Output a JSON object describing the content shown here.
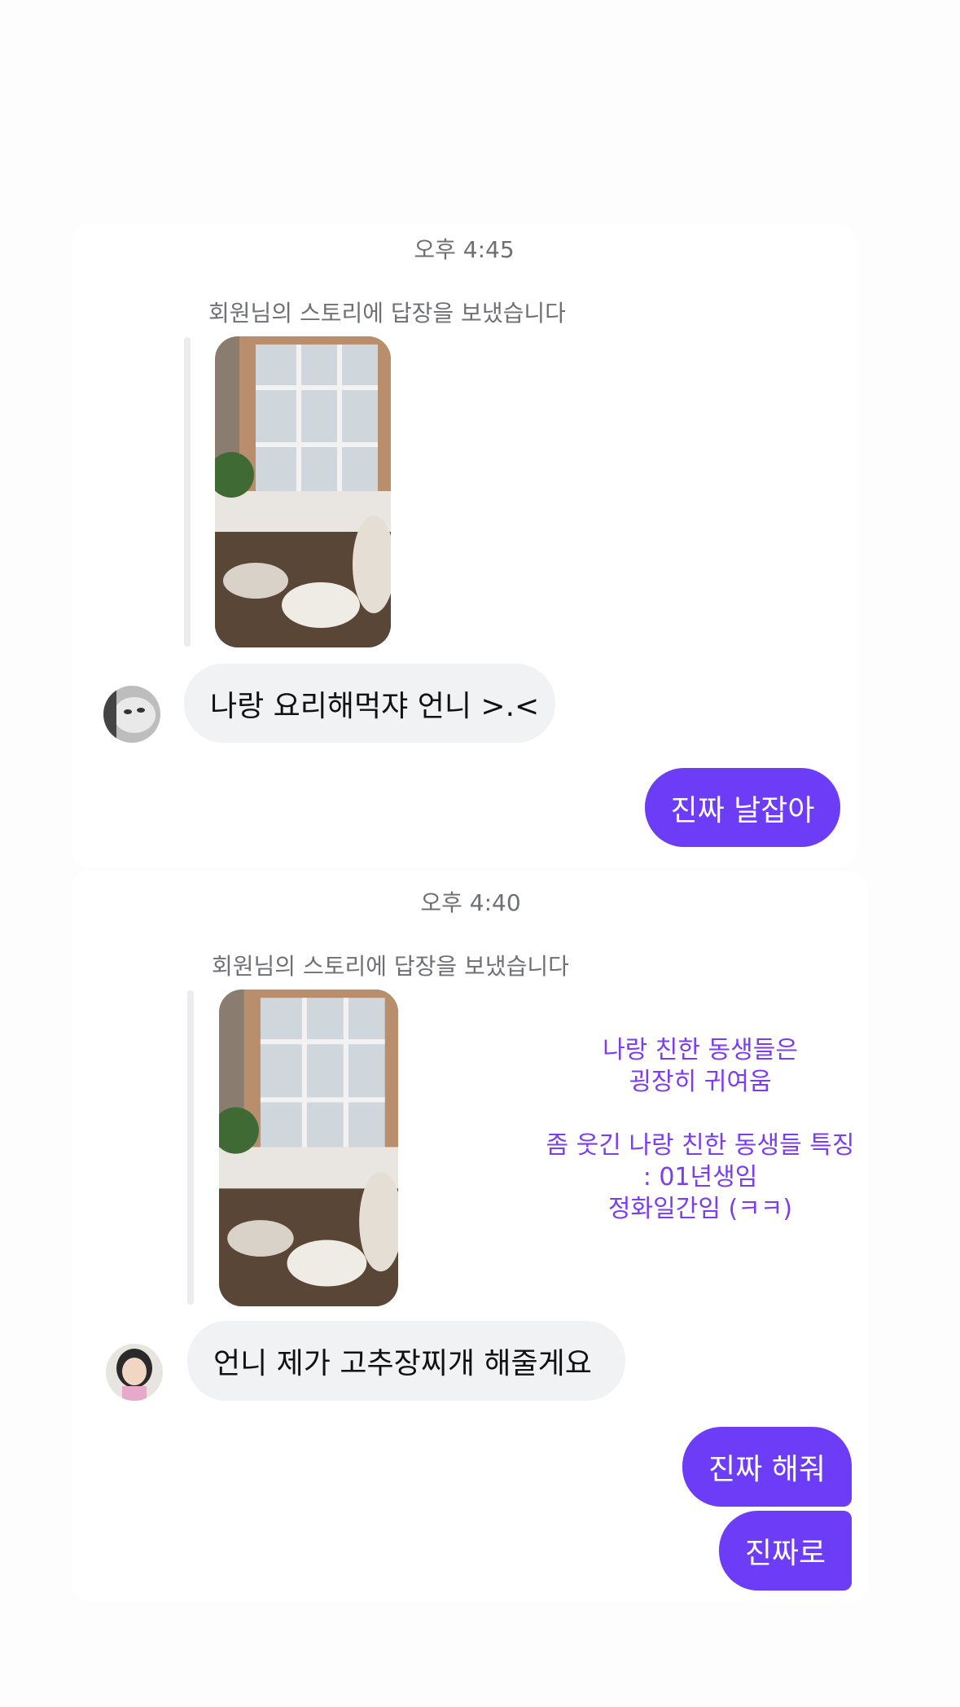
{
  "threads": [
    {
      "timestamp": "오후 4:45",
      "story_caption": "회원님의 스토리에 답장을 보냈습니다",
      "incoming": "나랑 요리해먹쟈 언니 >.<",
      "outgoing": [
        "진짜 날잡아"
      ]
    },
    {
      "timestamp": "오후 4:40",
      "story_caption": "회원님의 스토리에 답장을 보냈습니다",
      "incoming": "언니 제가 고추장찌개 해줄게요",
      "outgoing": [
        "진짜 해줘",
        "진짜로"
      ]
    }
  ],
  "overlay_note": {
    "line1": "나랑 친한 동생들은",
    "line2": "굉장히 귀여움",
    "line3": "좀 웃긴 나랑 친한 동생들 특징",
    "line4": ": 01년생임",
    "line5": "정화일간임 (ㅋㅋ)"
  },
  "colors": {
    "outgoing_bubble": "#6c3cf6",
    "incoming_bubble": "#f1f2f4",
    "note_text": "#7b3cf2"
  }
}
